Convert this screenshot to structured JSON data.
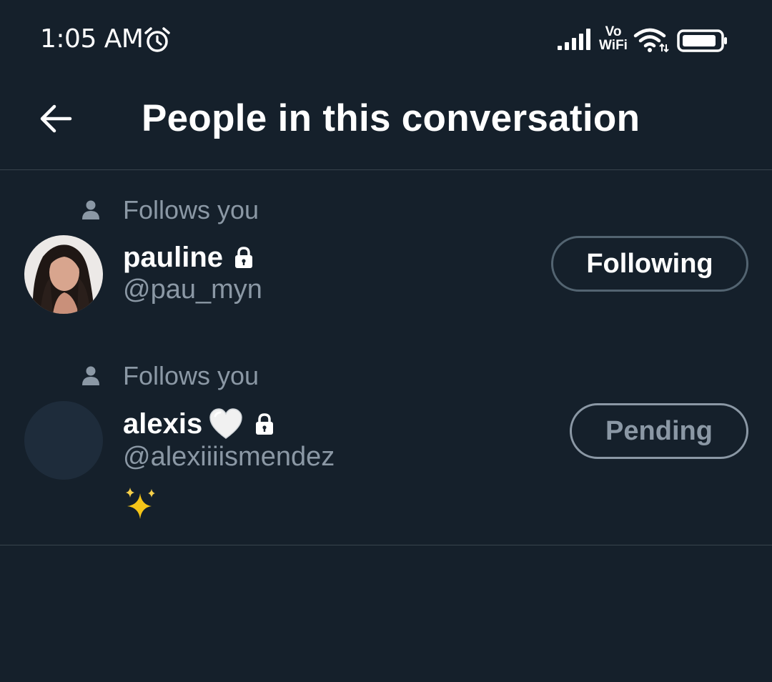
{
  "status_bar": {
    "time": "1:05 AM",
    "alarm_icon": "alarm-clock-icon",
    "signal_icon": "cell-signal-icon",
    "vowifi_line1": "Vo",
    "vowifi_line2": "WiFi",
    "wifi_icon": "wifi-icon",
    "battery_icon": "battery-icon"
  },
  "header": {
    "back_icon": "arrow-left-icon",
    "title": "People in this conversation"
  },
  "people": [
    {
      "follows_label": "Follows you",
      "name": "pauline",
      "handle": "@pau_myn",
      "protected": true,
      "button_label": "Following"
    },
    {
      "follows_label": "Follows you",
      "name": "alexis",
      "name_emoji": "white-heart-icon",
      "handle": "@alexiiiismendez",
      "protected": true,
      "bio_emoji": "sparkles-icon",
      "button_label": "Pending"
    }
  ],
  "colors": {
    "background": "#15202b",
    "secondary_text": "#8b98a5",
    "divider": "#38444d",
    "button_border": "#536471"
  }
}
